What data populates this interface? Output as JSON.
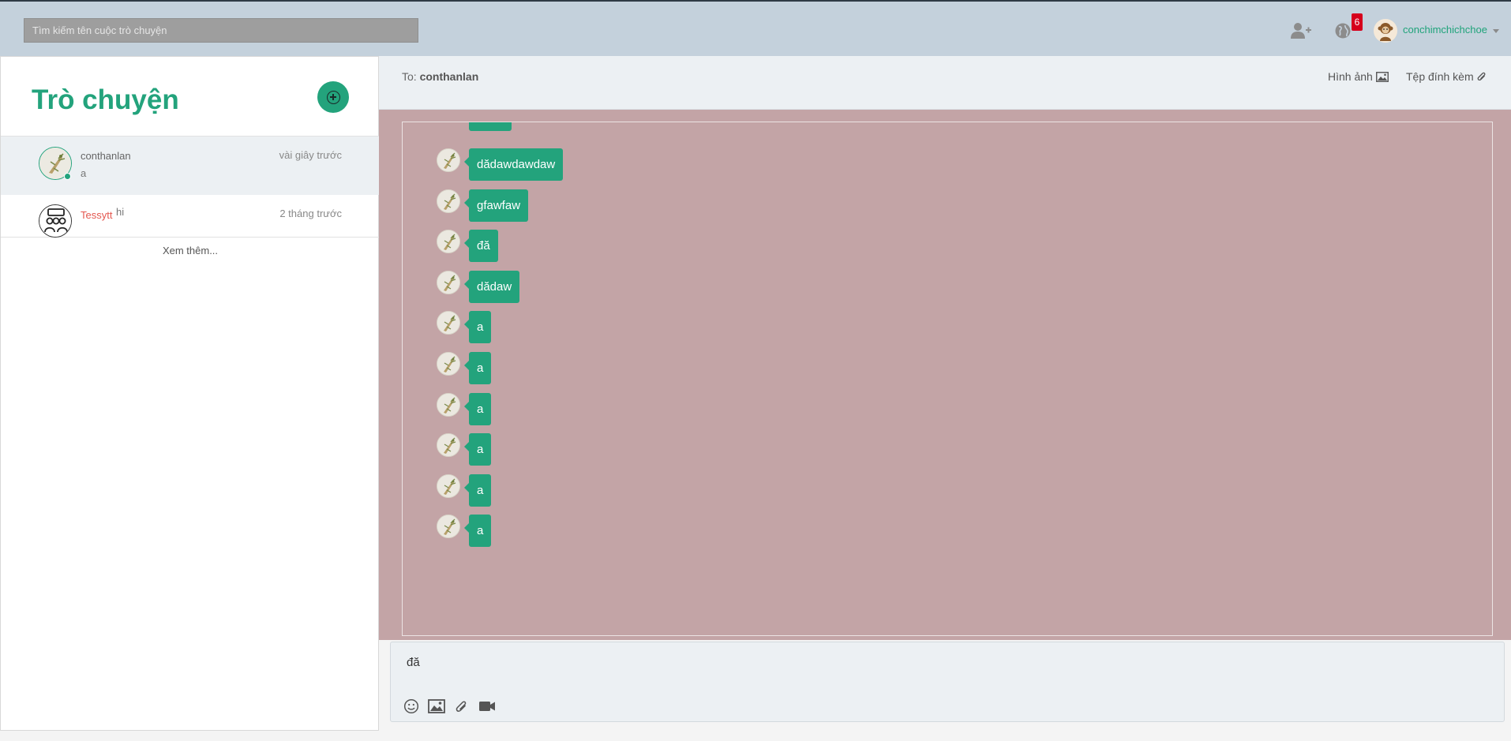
{
  "topbar": {
    "search_placeholder": "Tìm kiếm tên cuộc trò chuyện",
    "notification_count": "6",
    "username": "conchimchichchoe",
    "icons": [
      "add-friend-icon",
      "globe-icon",
      "user-avatar",
      "chevron-down-icon"
    ]
  },
  "sidebar": {
    "title": "Trò chuyện",
    "conversations": [
      {
        "name": "conthanlan",
        "last_message": "a",
        "time": "vài giây trước",
        "online": true
      },
      {
        "name": "Tessytt",
        "last_message": "hi",
        "time": "2 tháng trước",
        "online": false
      }
    ],
    "see_more": "Xem thêm..."
  },
  "chat": {
    "to_label": "To:",
    "to_name": "conthanlan",
    "images_label": "Hình ảnh",
    "attachments_label": "Tệp đính kèm",
    "messages": [
      "dădawdawdaw",
      "gfawfaw",
      "đă",
      "dădaw",
      "a",
      "a",
      "a",
      "a",
      "a",
      "a"
    ],
    "composer_value": "đă",
    "composer_icons": [
      "emoji-icon",
      "image-icon",
      "paperclip-icon",
      "video-icon"
    ]
  },
  "colors": {
    "accent": "#23a37c",
    "topbar": "#c4d1dc",
    "chat_background": "#c3a4a6",
    "badge": "#d6001c",
    "tessytt_name": "#e4574f"
  }
}
